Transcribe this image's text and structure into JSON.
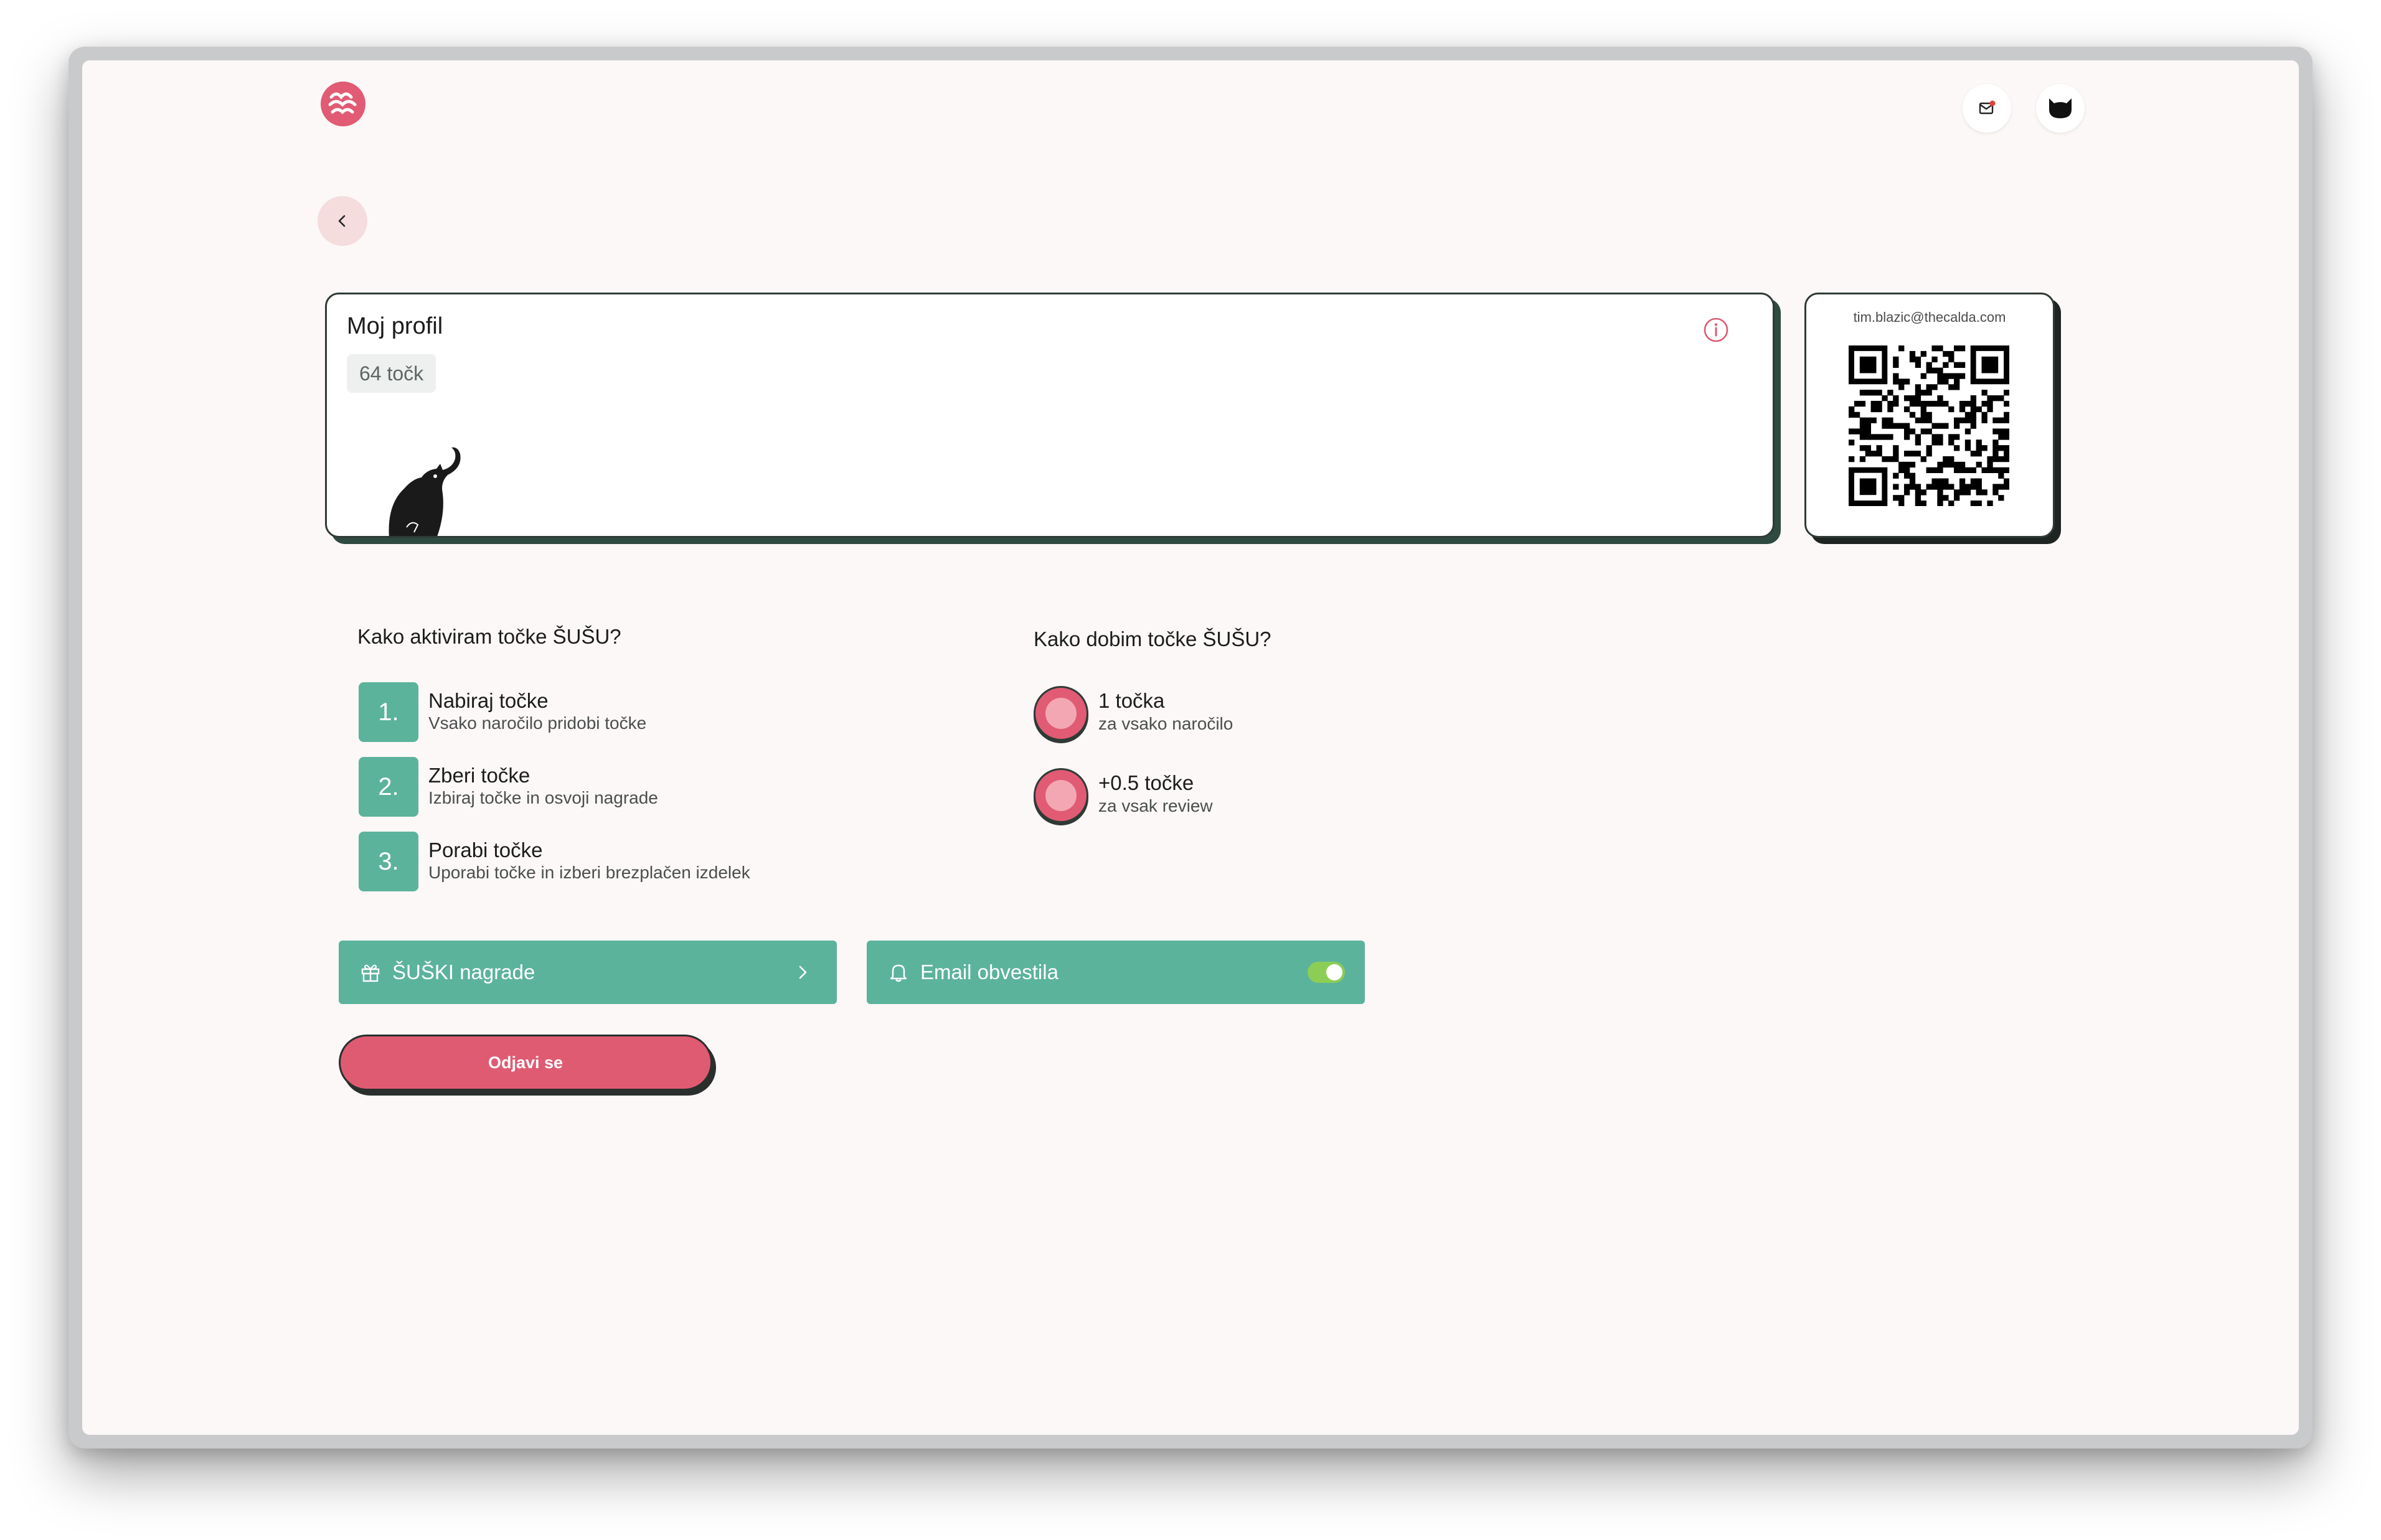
{
  "header": {
    "logo_icon": "susu-logo-icon",
    "inbox_icon": "mail-notification-icon",
    "avatar_icon": "cat-avatar-icon"
  },
  "nav": {
    "back_icon": "chevron-left-icon"
  },
  "profile": {
    "title": "Moj profil",
    "points": "64 točk",
    "info_icon": "info-icon"
  },
  "qr": {
    "email": "tim.blazic@thecalda.com"
  },
  "activate": {
    "title": "Kako aktiviram točke ŠUŠU?",
    "steps": [
      {
        "num": "1.",
        "title": "Nabiraj točke",
        "desc": "Vsako naročilo pridobi točke"
      },
      {
        "num": "2.",
        "title": "Zberi točke",
        "desc": "Izbiraj točke in osvoji nagrade"
      },
      {
        "num": "3.",
        "title": "Porabi točke",
        "desc": "Uporabi točke in izberi brezplačen izdelek"
      }
    ]
  },
  "earn": {
    "title": "Kako dobim točke ŠUŠU?",
    "items": [
      {
        "title": "1 točka",
        "desc": "za vsako naročilo"
      },
      {
        "title": "+0.5 točke",
        "desc": "za vsak review"
      }
    ]
  },
  "actions": {
    "rewards_label": "ŠUŠKI nagrade",
    "email_label": "Email obvestila",
    "email_enabled": true,
    "logout_label": "Odjavi se"
  },
  "colors": {
    "background": "#fcf8f7",
    "accent_green": "#5cb39c",
    "accent_pink": "#df5b72",
    "toggle_on": "#8ccd55",
    "dark": "#2f3a36"
  }
}
